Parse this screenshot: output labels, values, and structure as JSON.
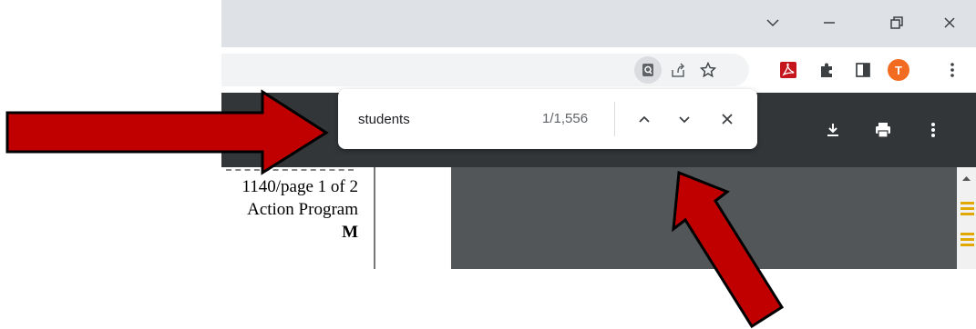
{
  "window_controls": {
    "icons": [
      "chevron-down-icon",
      "minimize-icon",
      "restore-icon",
      "close-icon"
    ]
  },
  "toolbar": {
    "profile_initial": "T",
    "profile_color": "#f26b21",
    "extension_colors": {
      "acrobat": "#c4161c"
    }
  },
  "find_bar": {
    "query": "students",
    "match_count": "1/1,556"
  },
  "document": {
    "lines": [
      "1140/page 1 of 2",
      "Action Program",
      "M"
    ]
  },
  "annotations": {
    "arrow_color": "#c00000"
  }
}
